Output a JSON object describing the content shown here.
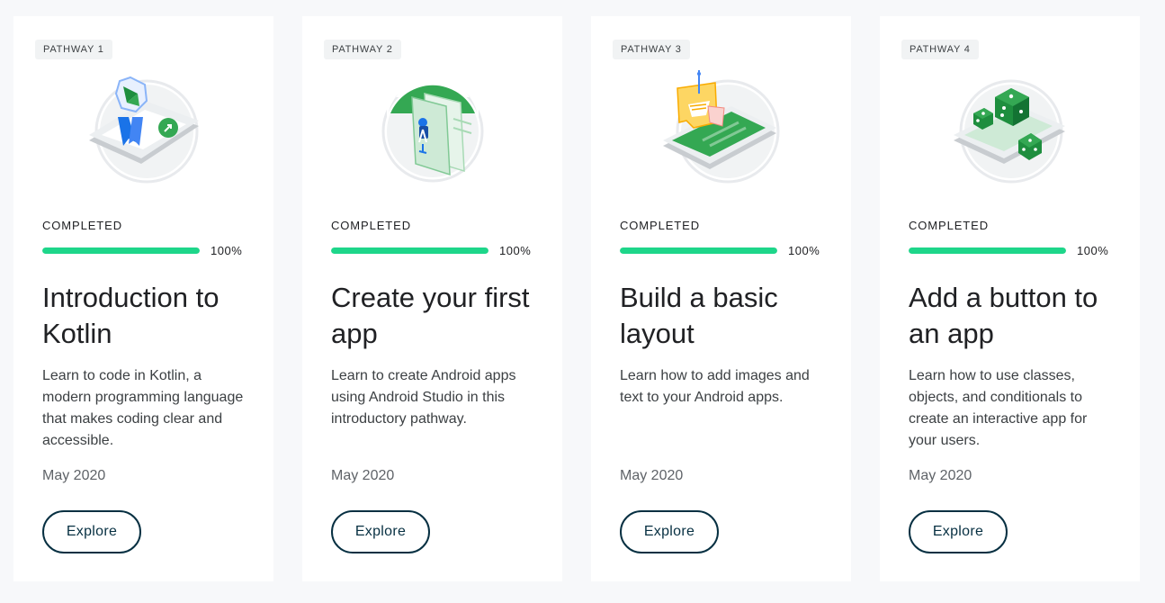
{
  "cards": [
    {
      "badge": "PATHWAY 1",
      "illustration_icon": "kotlin-award-phone-icon",
      "status": "COMPLETED",
      "progress_percent": 100,
      "progress_label": "100%",
      "title": "Introduction to Kotlin",
      "description": "Learn to code in Kotlin, a modern programming language that makes coding clear and accessible.",
      "date": "May 2020",
      "button_label": "Explore"
    },
    {
      "badge": "PATHWAY 2",
      "illustration_icon": "android-studio-app-icon",
      "status": "COMPLETED",
      "progress_percent": 100,
      "progress_label": "100%",
      "title": "Create your first app",
      "description": "Learn to create Android apps using Android Studio in this introductory pathway.",
      "date": "May 2020",
      "button_label": "Explore"
    },
    {
      "badge": "PATHWAY 3",
      "illustration_icon": "layout-phone-cards-icon",
      "status": "COMPLETED",
      "progress_percent": 100,
      "progress_label": "100%",
      "title": "Build a basic layout",
      "description": "Learn how to add images and text to your Android apps.",
      "date": "May 2020",
      "button_label": "Explore"
    },
    {
      "badge": "PATHWAY 4",
      "illustration_icon": "dice-phone-icon",
      "status": "COMPLETED",
      "progress_percent": 100,
      "progress_label": "100%",
      "title": "Add a button to an app",
      "description": "Learn how to use classes, objects, and conditionals to create an interactive app for your users.",
      "date": "May 2020",
      "button_label": "Explore"
    }
  ],
  "colors": {
    "progress_fill": "#1ed68a",
    "button_border": "#073042",
    "illustration_green": "#34a853"
  }
}
